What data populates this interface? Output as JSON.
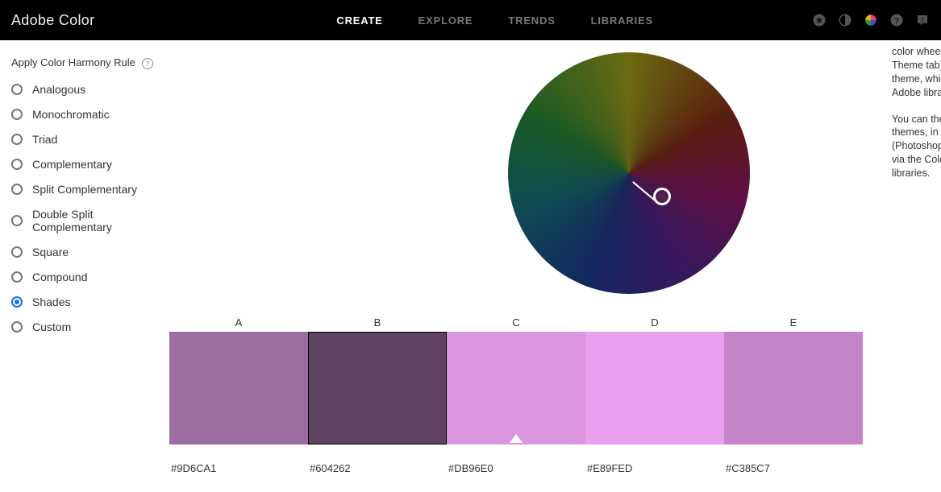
{
  "brand": "Adobe Color",
  "nav": {
    "create": "CREATE",
    "explore": "EXPLORE",
    "trends": "TRENDS",
    "libraries": "LIBRARIES"
  },
  "sidebar": {
    "title": "Apply Color Harmony Rule",
    "rules": [
      {
        "label": "Analogous",
        "selected": false
      },
      {
        "label": "Monochromatic",
        "selected": false
      },
      {
        "label": "Triad",
        "selected": false
      },
      {
        "label": "Complementary",
        "selected": false
      },
      {
        "label": "Split Complementary",
        "selected": false
      },
      {
        "label": "Double Split Complementary",
        "selected": false
      },
      {
        "label": "Square",
        "selected": false
      },
      {
        "label": "Compound",
        "selected": false
      },
      {
        "label": "Shades",
        "selected": true
      },
      {
        "label": "Custom",
        "selected": false
      }
    ]
  },
  "swatches": {
    "labels": [
      "A",
      "B",
      "C",
      "D",
      "E"
    ],
    "colors": [
      "#9D6CA1",
      "#604262",
      "#DB96E0",
      "#E89FED",
      "#C385C7"
    ],
    "hex": [
      "#9D6CA1",
      "#604262",
      "#DB96E0",
      "#E89FED",
      "#C385C7"
    ],
    "selected_index": 1,
    "pointer_index": 2
  },
  "right": {
    "p1": "color wheel (or via the Extract Theme tab) can be used to create a theme, which can be saved to Adobe libraries after signing in.",
    "p2": "You can then use these color themes, in Adobe products (Photoshop, Illustrator, Fresco etc.) via the Color theme panel / libraries."
  }
}
